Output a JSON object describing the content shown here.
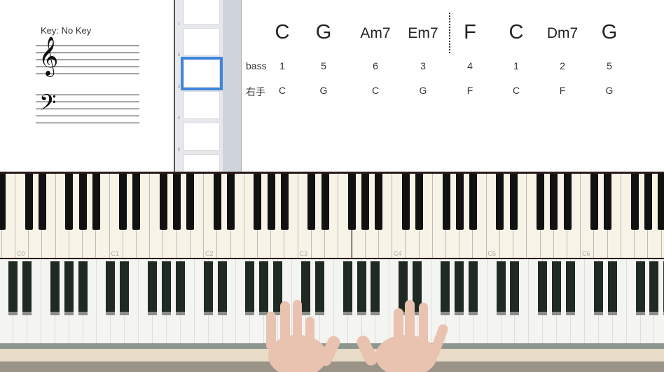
{
  "sheet": {
    "key_label": "Key: No Key"
  },
  "slides": {
    "count": 6,
    "selected": 3,
    "numbers": [
      "1",
      "2",
      "3",
      "4",
      "5",
      "6"
    ]
  },
  "chords": [
    {
      "name": "C",
      "bass": "1",
      "right": "C"
    },
    {
      "name": "G",
      "bass": "5",
      "right": "G"
    },
    {
      "name": "Am7",
      "bass": "6",
      "right": "C"
    },
    {
      "name": "Em7",
      "bass": "3",
      "right": "G"
    },
    {
      "name": "F",
      "bass": "4",
      "right": "F"
    },
    {
      "name": "C",
      "bass": "1",
      "right": "C"
    },
    {
      "name": "Dm7",
      "bass": "2",
      "right": "F"
    },
    {
      "name": "G",
      "bass": "5",
      "right": "G"
    }
  ],
  "rows": {
    "bass_label": "bass",
    "right_label": "右手"
  },
  "keyboard": {
    "octave_labels": [
      "C0",
      "C1",
      "C2",
      "C3",
      "C4",
      "C5",
      "C6"
    ]
  },
  "colors": {
    "selection": "#3f86dc",
    "white_key": "#f7f3e6",
    "black_key": "#111111"
  }
}
